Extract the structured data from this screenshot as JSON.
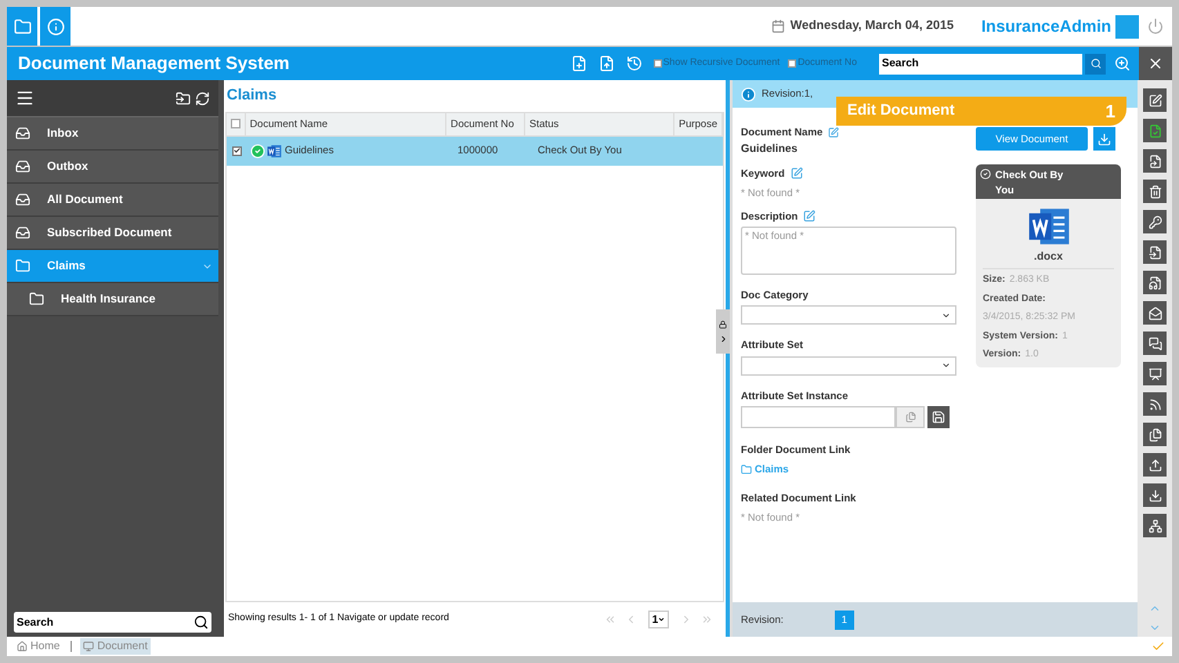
{
  "top_bar": {
    "date": "Wednesday, March 04, 2015",
    "user": "InsuranceAdmin"
  },
  "title_bar": {
    "title": "Document Management System",
    "options": [
      {
        "label": "Show Recursive Document",
        "checked": false
      },
      {
        "label": "Document No",
        "checked": false
      }
    ],
    "search": {
      "value": "Search"
    }
  },
  "sidebar": {
    "items": [
      {
        "label": "Inbox",
        "kind": "tray",
        "selected": false
      },
      {
        "label": "Outbox",
        "kind": "tray",
        "selected": false
      },
      {
        "label": "All Document",
        "kind": "tray",
        "selected": false
      },
      {
        "label": "Subscribed Document",
        "kind": "tray",
        "selected": false
      },
      {
        "label": "Claims",
        "kind": "folder",
        "selected": true,
        "expanded": true,
        "children": [
          {
            "label": "Health Insurance",
            "kind": "folder",
            "selected": false
          }
        ]
      }
    ],
    "search": {
      "placeholder": "Search"
    }
  },
  "table": {
    "title": "Claims",
    "select_all_checked": false,
    "columns": [
      "Document Name",
      "Document No",
      "Status",
      "Purpose"
    ],
    "rows": [
      {
        "selected": true,
        "checked": true,
        "cells": [
          "Guidelines",
          "1000000",
          "Check Out By You",
          ""
        ]
      }
    ],
    "footer": "Showing results 1- 1 of 1 Navigate or update record",
    "page": "1"
  },
  "detail": {
    "banner": "Revision:1,",
    "callout": {
      "label": "Edit Document",
      "number": "1"
    },
    "document_name_label": "Document Name",
    "document_name": "Guidelines",
    "keyword_label": "Keyword",
    "keyword": "* Not found *",
    "description_label": "Description",
    "description": "* Not found *",
    "doc_category_label": "Doc Category",
    "attribute_set_label": "Attribute Set",
    "attribute_set_instance_label": "Attribute Set Instance",
    "folder_link_label": "Folder Document Link",
    "folder_link": "Claims",
    "related_link_label": "Related Document Link",
    "related_link": "* Not found *",
    "view_button": "View Document",
    "status": "Check Out By You",
    "file_type": ".docx",
    "info": [
      {
        "label": "Size:",
        "value": "2.863 KB",
        "inline": true
      },
      {
        "label": "Created Date:",
        "value": "3/4/2015, 8:25:32 PM",
        "inline": false
      },
      {
        "label": "System Version:",
        "value": "1",
        "inline": true
      },
      {
        "label": "Version:",
        "value": "1.0",
        "inline": true
      }
    ],
    "revision_label": "Revision:",
    "revision_page": "1"
  },
  "breadcrumb": [
    {
      "label": "Home",
      "selected": false
    },
    {
      "label": "Document",
      "selected": true
    }
  ]
}
